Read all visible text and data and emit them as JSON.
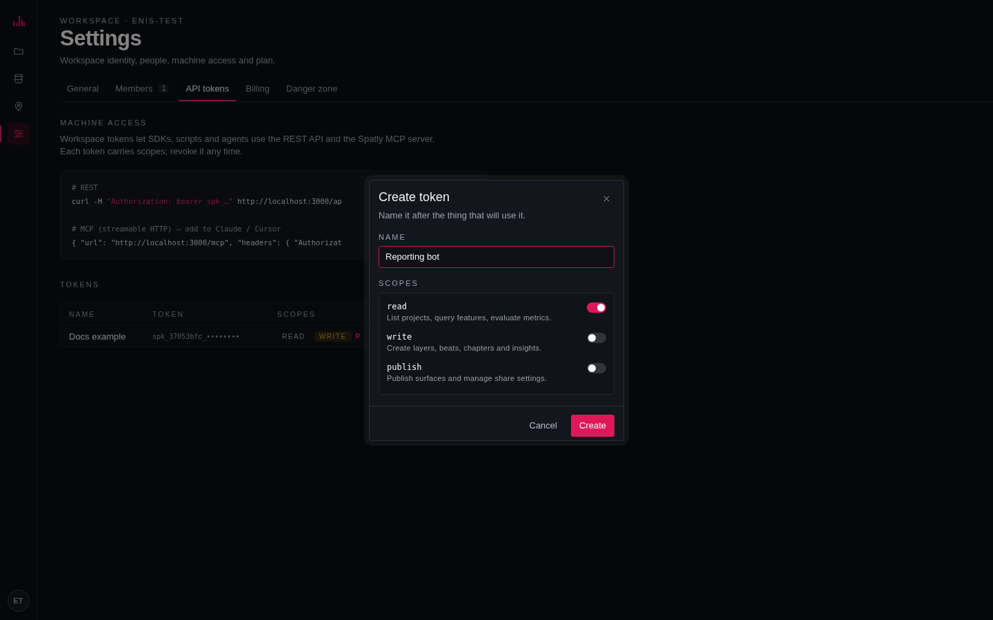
{
  "sidebar": {
    "items": [
      {
        "kind": "folder",
        "selected": false
      },
      {
        "kind": "database",
        "selected": false
      },
      {
        "kind": "pin",
        "selected": false
      },
      {
        "kind": "sliders",
        "selected": true
      }
    ],
    "avatar": "ET"
  },
  "header": {
    "breadcrumb": "WORKSPACE · ENIS-TEST",
    "title": "Settings",
    "subtitle": "Workspace identity, people, machine access and plan."
  },
  "tabs": [
    {
      "label": "General",
      "selected": false
    },
    {
      "label": "Members",
      "badge": "1",
      "selected": false
    },
    {
      "label": "API tokens",
      "selected": true
    },
    {
      "label": "Billing",
      "selected": false
    },
    {
      "label": "Danger zone",
      "selected": false
    }
  ],
  "machine_access": {
    "heading": "MACHINE ACCESS",
    "description": "Workspace tokens let SDKs, scripts and agents use the REST API and the Spatly MCP server.\nEach token carries scopes; revoke it any time.",
    "code_blocks": [
      {
        "lines": [
          [
            {
              "kind": "comment",
              "text": "# REST"
            }
          ],
          [
            {
              "kind": "plain",
              "text": "curl -H "
            },
            {
              "kind": "string",
              "text": "\"Authorization: Bearer spk_…\""
            },
            {
              "kind": "plain",
              "text": " http://localhost:3000/ap"
            }
          ]
        ]
      },
      {
        "lines": [
          [
            {
              "kind": "comment",
              "text": "# MCP (streamable HTTP) — add to Claude / Cursor"
            }
          ],
          [
            {
              "kind": "plain",
              "text": "{ \"url\": \"http://localhost:3000/mcp\", \"headers\": { \"Authorizat"
            }
          ]
        ]
      }
    ]
  },
  "tokens": {
    "heading": "TOKENS",
    "columns": [
      "NAME",
      "TOKEN",
      "SCOPES"
    ],
    "rows": [
      {
        "name": "Docs example",
        "token": "spk_37053bfc_••••••••",
        "scopes": [
          {
            "text": "READ",
            "kind": "plain"
          },
          {
            "text": "WRITE",
            "kind": "tag"
          },
          {
            "text": "P",
            "kind": "text"
          }
        ]
      }
    ]
  },
  "dialog": {
    "title": "Create token",
    "subtitle": "Name it after the thing that will use it.",
    "name_label": "NAME",
    "name_value": "Reporting bot",
    "scopes_label": "SCOPES",
    "scopes": [
      {
        "name": "read",
        "description": "List projects, query features, evaluate metrics.",
        "on": true
      },
      {
        "name": "write",
        "description": "Create layers, beats, chapters and insights.",
        "on": false
      },
      {
        "name": "publish",
        "description": "Publish surfaces and manage share settings.",
        "on": false
      }
    ],
    "buttons": [
      {
        "label": "Cancel",
        "kind": "secondary"
      },
      {
        "label": "Create",
        "kind": "primary"
      }
    ]
  }
}
